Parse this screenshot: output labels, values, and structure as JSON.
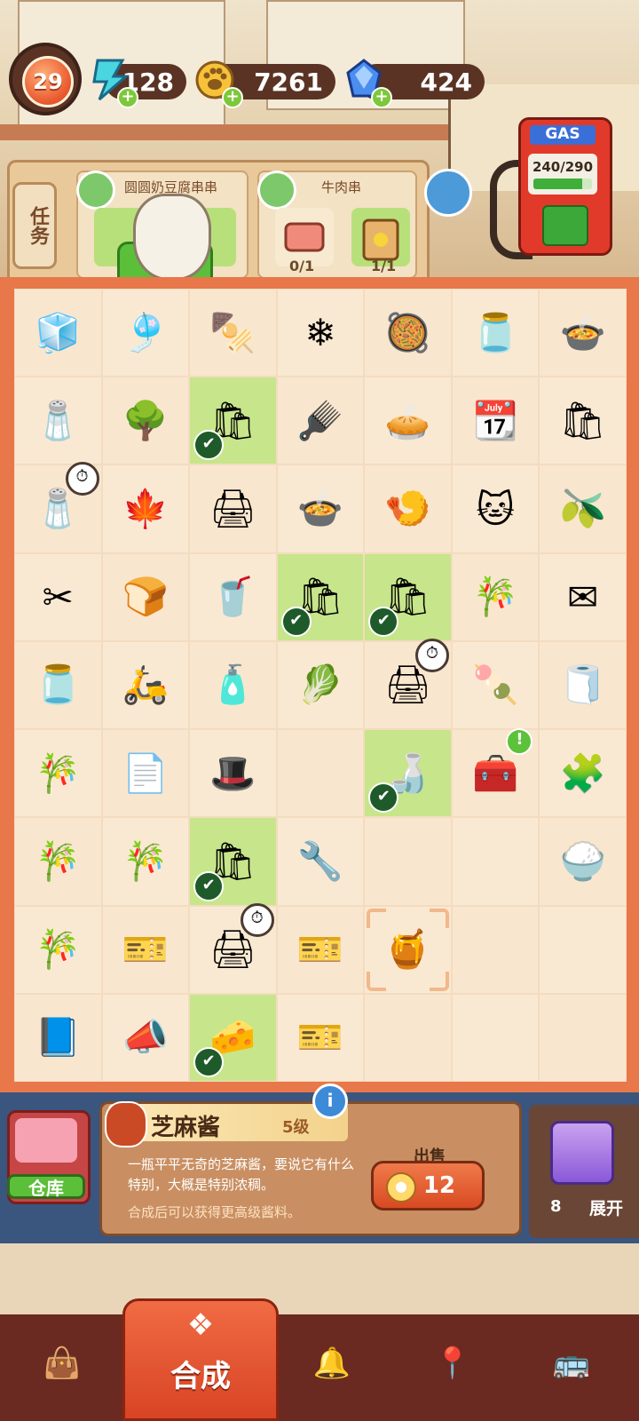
{
  "status": {
    "level": "29",
    "energy": "128",
    "coins": "7261",
    "gems": "424"
  },
  "tasks": {
    "tab_label": "任务",
    "orders": [
      {
        "name": "圆圆奶豆腐串串",
        "progress": ""
      },
      {
        "name": "牛肉串",
        "progress_1": "0/1",
        "progress_2": "1/1"
      }
    ]
  },
  "gas": {
    "label": "GAS",
    "value": "240/290",
    "fill_fraction": 0.83
  },
  "grid": {
    "rows": [
      [
        "fridge-icon",
        "phone-strap-icon",
        "rice-cooker-skewers-icon",
        "snowflake-icon",
        "braised-dish-icon",
        "jar-icon",
        "soup-bowl-icon"
      ],
      [
        "spice-shelf-icon",
        "bonsai-tree-icon",
        "delivery-bag-done",
        "hair-brush-icon",
        "egg-tarts-icon",
        "calendar-icon",
        "shopping-bag-icon"
      ],
      [
        "spice-rack-timer-icon",
        "maple-leaves-icon",
        "printer-icon",
        "hotpot-icon",
        "shrimp-bowl-icon",
        "lucky-cat-icon",
        "olive-icon"
      ],
      [
        "scissors-icon",
        "toast-icon",
        "cup-icon",
        "delivery-bag-done",
        "delivery-bag-done",
        "sugarcane-icon",
        "envelope-icon"
      ],
      [
        "sugar-jar-icon",
        "scooter-icon",
        "ink-bottle-icon",
        "cabbage-icon",
        "printer-timer-icon",
        "meatball-icon",
        "towel-icon"
      ],
      [
        "sugarcane-bundle-icon",
        "paper-sheet-icon",
        "chef-hat-icon",
        "",
        "sauce-bottle-done",
        "treasure-chest-alert",
        "puzzle-icon"
      ],
      [
        "sugarcane-bundle-icon",
        "sugarcane-stick-icon",
        "delivery-bag-done",
        "wrench-icon",
        "",
        "",
        "rice-tray-icon"
      ],
      [
        "sugarcane-sprout-icon",
        "coupon-book-icon",
        "printer-timer-icon",
        "coupon-stack-icon",
        "sesame-jar-selected",
        "",
        ""
      ],
      [
        "notebook-icon",
        "megaphone-icon",
        "tofu-done",
        "coupon-stack-icon",
        "",
        "",
        ""
      ]
    ]
  },
  "info": {
    "name": "芝麻酱",
    "level": "5级",
    "desc": "一瓶平平无奇的芝麻酱，要说它有什么特别，大概是特别浓稠。",
    "hint": "合成后可以获得更高级酱料。",
    "sell_label": "出售",
    "sell_price": "12"
  },
  "storage": {
    "label": "仓库"
  },
  "box": {
    "count": "8",
    "label": "展开"
  },
  "nav": {
    "merge_label": "合成",
    "tabs": [
      "shop-bag-icon",
      "merge-icon",
      "cloche-icon",
      "map-pin-icon",
      "bus-icon"
    ]
  }
}
